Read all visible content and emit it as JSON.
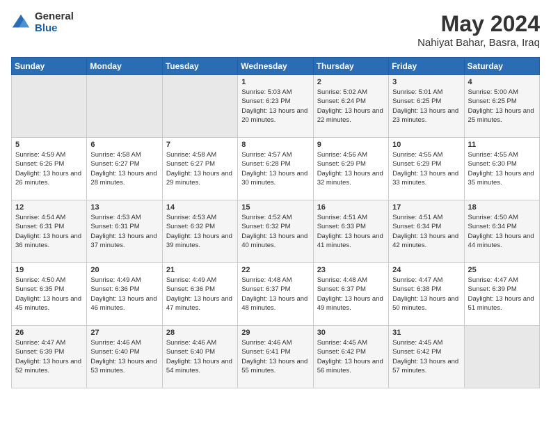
{
  "header": {
    "logo_general": "General",
    "logo_blue": "Blue",
    "title": "May 2024",
    "location": "Nahiyat Bahar, Basra, Iraq"
  },
  "weekdays": [
    "Sunday",
    "Monday",
    "Tuesday",
    "Wednesday",
    "Thursday",
    "Friday",
    "Saturday"
  ],
  "weeks": [
    [
      {
        "day": "",
        "empty": true
      },
      {
        "day": "",
        "empty": true
      },
      {
        "day": "",
        "empty": true
      },
      {
        "day": "1",
        "sunrise": "5:03 AM",
        "sunset": "6:23 PM",
        "daylight": "13 hours and 20 minutes."
      },
      {
        "day": "2",
        "sunrise": "5:02 AM",
        "sunset": "6:24 PM",
        "daylight": "13 hours and 22 minutes."
      },
      {
        "day": "3",
        "sunrise": "5:01 AM",
        "sunset": "6:25 PM",
        "daylight": "13 hours and 23 minutes."
      },
      {
        "day": "4",
        "sunrise": "5:00 AM",
        "sunset": "6:25 PM",
        "daylight": "13 hours and 25 minutes."
      }
    ],
    [
      {
        "day": "5",
        "sunrise": "4:59 AM",
        "sunset": "6:26 PM",
        "daylight": "13 hours and 26 minutes."
      },
      {
        "day": "6",
        "sunrise": "4:58 AM",
        "sunset": "6:27 PM",
        "daylight": "13 hours and 28 minutes."
      },
      {
        "day": "7",
        "sunrise": "4:58 AM",
        "sunset": "6:27 PM",
        "daylight": "13 hours and 29 minutes."
      },
      {
        "day": "8",
        "sunrise": "4:57 AM",
        "sunset": "6:28 PM",
        "daylight": "13 hours and 30 minutes."
      },
      {
        "day": "9",
        "sunrise": "4:56 AM",
        "sunset": "6:29 PM",
        "daylight": "13 hours and 32 minutes."
      },
      {
        "day": "10",
        "sunrise": "4:55 AM",
        "sunset": "6:29 PM",
        "daylight": "13 hours and 33 minutes."
      },
      {
        "day": "11",
        "sunrise": "4:55 AM",
        "sunset": "6:30 PM",
        "daylight": "13 hours and 35 minutes."
      }
    ],
    [
      {
        "day": "12",
        "sunrise": "4:54 AM",
        "sunset": "6:31 PM",
        "daylight": "13 hours and 36 minutes."
      },
      {
        "day": "13",
        "sunrise": "4:53 AM",
        "sunset": "6:31 PM",
        "daylight": "13 hours and 37 minutes."
      },
      {
        "day": "14",
        "sunrise": "4:53 AM",
        "sunset": "6:32 PM",
        "daylight": "13 hours and 39 minutes."
      },
      {
        "day": "15",
        "sunrise": "4:52 AM",
        "sunset": "6:32 PM",
        "daylight": "13 hours and 40 minutes."
      },
      {
        "day": "16",
        "sunrise": "4:51 AM",
        "sunset": "6:33 PM",
        "daylight": "13 hours and 41 minutes."
      },
      {
        "day": "17",
        "sunrise": "4:51 AM",
        "sunset": "6:34 PM",
        "daylight": "13 hours and 42 minutes."
      },
      {
        "day": "18",
        "sunrise": "4:50 AM",
        "sunset": "6:34 PM",
        "daylight": "13 hours and 44 minutes."
      }
    ],
    [
      {
        "day": "19",
        "sunrise": "4:50 AM",
        "sunset": "6:35 PM",
        "daylight": "13 hours and 45 minutes."
      },
      {
        "day": "20",
        "sunrise": "4:49 AM",
        "sunset": "6:36 PM",
        "daylight": "13 hours and 46 minutes."
      },
      {
        "day": "21",
        "sunrise": "4:49 AM",
        "sunset": "6:36 PM",
        "daylight": "13 hours and 47 minutes."
      },
      {
        "day": "22",
        "sunrise": "4:48 AM",
        "sunset": "6:37 PM",
        "daylight": "13 hours and 48 minutes."
      },
      {
        "day": "23",
        "sunrise": "4:48 AM",
        "sunset": "6:37 PM",
        "daylight": "13 hours and 49 minutes."
      },
      {
        "day": "24",
        "sunrise": "4:47 AM",
        "sunset": "6:38 PM",
        "daylight": "13 hours and 50 minutes."
      },
      {
        "day": "25",
        "sunrise": "4:47 AM",
        "sunset": "6:39 PM",
        "daylight": "13 hours and 51 minutes."
      }
    ],
    [
      {
        "day": "26",
        "sunrise": "4:47 AM",
        "sunset": "6:39 PM",
        "daylight": "13 hours and 52 minutes."
      },
      {
        "day": "27",
        "sunrise": "4:46 AM",
        "sunset": "6:40 PM",
        "daylight": "13 hours and 53 minutes."
      },
      {
        "day": "28",
        "sunrise": "4:46 AM",
        "sunset": "6:40 PM",
        "daylight": "13 hours and 54 minutes."
      },
      {
        "day": "29",
        "sunrise": "4:46 AM",
        "sunset": "6:41 PM",
        "daylight": "13 hours and 55 minutes."
      },
      {
        "day": "30",
        "sunrise": "4:45 AM",
        "sunset": "6:42 PM",
        "daylight": "13 hours and 56 minutes."
      },
      {
        "day": "31",
        "sunrise": "4:45 AM",
        "sunset": "6:42 PM",
        "daylight": "13 hours and 57 minutes."
      },
      {
        "day": "",
        "empty": true
      }
    ]
  ]
}
